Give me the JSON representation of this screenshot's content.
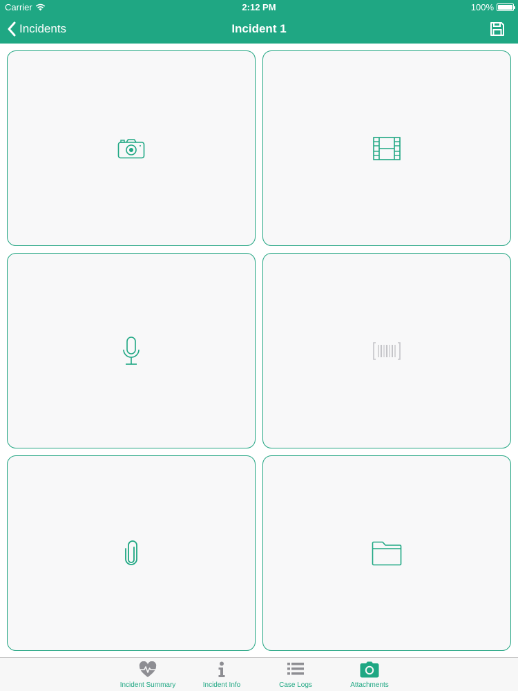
{
  "status_bar": {
    "carrier": "Carrier",
    "time": "2:12 PM",
    "battery": "100%"
  },
  "nav": {
    "back_label": "Incidents",
    "title": "Incident 1",
    "save_icon": "save-icon"
  },
  "colors": {
    "accent": "#1fa783",
    "tile_border": "#22a582",
    "tile_background": "#f8f8f9",
    "disabled_icon": "#c4c4c8",
    "tab_inactive": "#8e8e93"
  },
  "tiles": [
    {
      "icon": "camera-icon",
      "enabled": true
    },
    {
      "icon": "film-icon",
      "enabled": true
    },
    {
      "icon": "microphone-icon",
      "enabled": true
    },
    {
      "icon": "barcode-icon",
      "enabled": false
    },
    {
      "icon": "paperclip-icon",
      "enabled": true
    },
    {
      "icon": "folder-icon",
      "enabled": true
    }
  ],
  "tabs": [
    {
      "label": "Incident Summary",
      "icon": "heart-pulse-icon",
      "selected": false
    },
    {
      "label": "Incident Info",
      "icon": "info-icon",
      "selected": false
    },
    {
      "label": "Case Logs",
      "icon": "list-icon",
      "selected": false
    },
    {
      "label": "Attachments",
      "icon": "camera-icon",
      "selected": true
    }
  ]
}
